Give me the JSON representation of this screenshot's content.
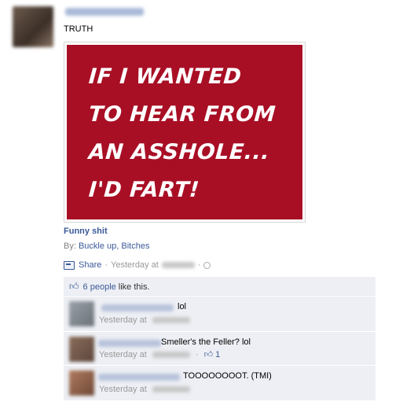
{
  "post": {
    "text": "TRUTH",
    "image_lines": [
      "IF I WANTED",
      "TO HEAR FROM",
      "AN ASSHOLE...",
      "I'D FART!"
    ],
    "link_title": "Funny shit",
    "by_prefix": "By:",
    "by_name": "Buckle up, Bitches",
    "share_label": "Share",
    "separator": "·",
    "time_text": "Yesterday at"
  },
  "likes": {
    "count_text": "6 people",
    "suffix": "like this."
  },
  "comments": [
    {
      "text": "lol",
      "time": "Yesterday at"
    },
    {
      "text": "Smeller's the Feller? lol",
      "time": "Yesterday at",
      "like_count": "1"
    },
    {
      "text": "TOOOOOOOOT.  (TMI)",
      "time": "Yesterday at"
    }
  ],
  "colors": {
    "link": "#3b5998",
    "image_bg": "#a80f25",
    "comment_bg": "#edeff4"
  }
}
